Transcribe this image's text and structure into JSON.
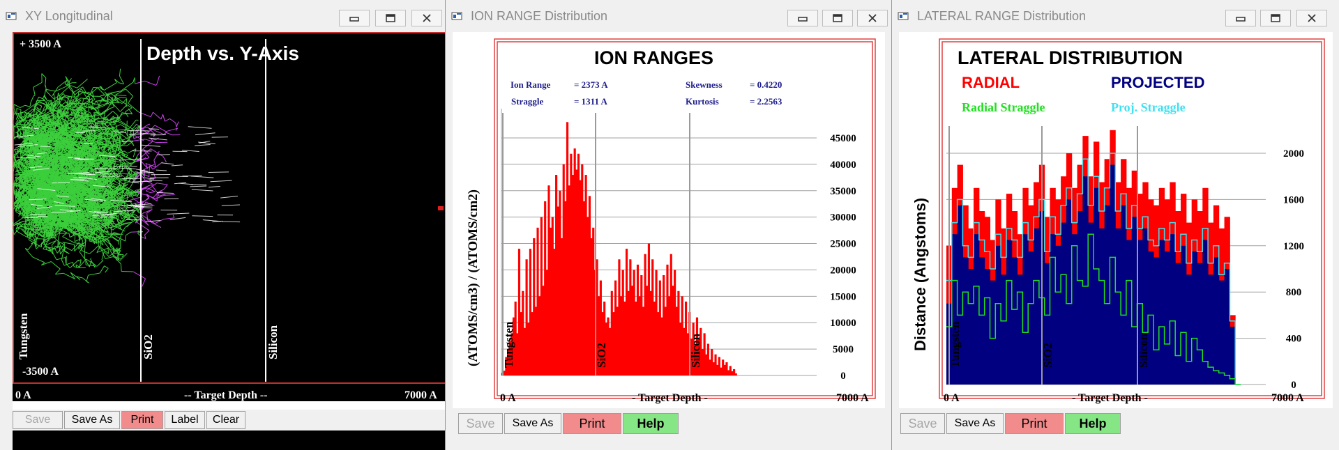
{
  "windows": [
    {
      "title": "XY Longitudinal",
      "plot": {
        "title": "Depth vs. Y-Axis",
        "y_top": "+ 3500 A",
        "y_bottom": "-3500 A",
        "x_left": "0 A",
        "x_mid": "-- Target Depth --",
        "x_right": "7000 A",
        "layers": [
          "Tungsten",
          "SiO2",
          "Silicon"
        ]
      },
      "toolbar": [
        "Save",
        "Save As",
        "Print",
        "Label",
        "Clear"
      ]
    },
    {
      "title": "ION RANGE Distribution",
      "toolbar": [
        "Save",
        "Save As",
        "Print",
        "Help"
      ]
    },
    {
      "title": "LATERAL RANGE Distribution",
      "toolbar": [
        "Save",
        "Save As",
        "Print",
        "Help"
      ]
    }
  ],
  "colors": {
    "red": "#ff0000",
    "navy": "#000080",
    "green": "#20e020",
    "cyan": "#40e0f0",
    "purple": "#cc40ee",
    "label_blue": "#1c1c8c"
  },
  "chart_data": [
    {
      "type": "bar",
      "title": "ION RANGES",
      "stats": {
        "ion_range_label": "Ion Range",
        "ion_range_value": "= 2373 A",
        "straggle_label": "Straggle",
        "straggle_value": "= 1311 A",
        "skewness_label": "Skewness",
        "skewness_value": "= 0.4220",
        "kurtosis_label": "Kurtosis",
        "kurtosis_value": "= 2.2563"
      },
      "ylabel": "(ATOMS/cm3) / (ATOMS/cm2)",
      "xlabel": "- Target Depth -",
      "x_left": "0 A",
      "x_right": "7000 A",
      "ylim": [
        0,
        45000
      ],
      "yticks": [
        "45000",
        "40000",
        "35000",
        "30000",
        "25000",
        "20000",
        "15000",
        "10000",
        "5000",
        "0"
      ],
      "layers": [
        "Tungsten",
        "SiO2",
        "Silicon"
      ],
      "layer_boundaries": [
        0,
        1800,
        3600
      ],
      "values": [
        500,
        900,
        3500,
        5000,
        6500,
        8000,
        11000,
        14000,
        8000,
        24000,
        12000,
        16000,
        9000,
        22000,
        10000,
        24000,
        12000,
        26000,
        13000,
        28000,
        15000,
        30000,
        17000,
        33000,
        20000,
        36000,
        28000,
        30000,
        24000,
        38000,
        32000,
        35000,
        26000,
        40000,
        33000,
        48000,
        36000,
        42000,
        38000,
        43000,
        39000,
        42000,
        37000,
        40000,
        33000,
        38000,
        30000,
        34000,
        26000,
        28000,
        20000,
        22000,
        15000,
        18000,
        12000,
        14000,
        10000,
        11000,
        9000,
        16000,
        12000,
        18000,
        13000,
        22000,
        15000,
        20000,
        14000,
        24000,
        16000,
        22000,
        17000,
        20000,
        14000,
        21000,
        15000,
        19000,
        13000,
        23000,
        17000,
        25000,
        16000,
        22000,
        14000,
        20000,
        12000,
        18000,
        11000,
        19000,
        13000,
        21000,
        15000,
        23000,
        17000,
        20000,
        13000,
        16000,
        10000,
        15000,
        9000,
        14000,
        8000,
        12000,
        7000,
        10000,
        6000,
        11000,
        7000,
        9000,
        5000,
        8000,
        4000,
        6000,
        3000,
        5000,
        2500,
        4000,
        2000,
        3500,
        1500,
        3000,
        2000,
        2500,
        1000,
        1800,
        800,
        1200,
        400,
        0
      ],
      "grid": true
    },
    {
      "type": "area",
      "title": "LATERAL DISTRIBUTION",
      "legend": [
        "RADIAL",
        "PROJECTED",
        "Radial Straggle",
        "Proj. Straggle"
      ],
      "ylabel": "Distance (Angstoms)",
      "xlabel": "- Target Depth -",
      "x_left": "0 A",
      "x_right": "7000 A",
      "ylim": [
        0,
        2200
      ],
      "yticks": [
        "2000",
        "1600",
        "1200",
        "800",
        "400",
        "0"
      ],
      "layers": [
        "Tungsten",
        "SiO2",
        "Silicon"
      ],
      "series": [
        {
          "name": "RADIAL",
          "values": [
            1200,
            1700,
            1900,
            1550,
            1350,
            1700,
            1500,
            1450,
            1250,
            1600,
            1350,
            1650,
            1500,
            1300,
            1700,
            1550,
            1750,
            1900,
            1450,
            1700,
            1600,
            1800,
            2000,
            1700,
            1900,
            2150,
            1800,
            2100,
            1750,
            1950,
            2200,
            1750,
            1950,
            1700,
            1850,
            1650,
            1750,
            1600,
            1550,
            1700,
            1600,
            1750,
            1500,
            1650,
            1400,
            1600,
            1500,
            1700,
            1400,
            1550,
            1350,
            1450,
            600,
            0
          ]
        },
        {
          "name": "PROJECTED",
          "values": [
            700,
            1300,
            1550,
            1100,
            1000,
            1300,
            1100,
            1000,
            900,
            1200,
            950,
            1250,
            1100,
            950,
            1300,
            1150,
            1350,
            1500,
            1050,
            1300,
            1200,
            1400,
            1600,
            1300,
            1500,
            1800,
            1400,
            1700,
            1350,
            1550,
            1900,
            1350,
            1550,
            1250,
            1450,
            1250,
            1350,
            1150,
            1100,
            1250,
            1150,
            1300,
            1050,
            1200,
            950,
            1150,
            1050,
            1250,
            950,
            1100,
            900,
            1000,
            500,
            0
          ]
        },
        {
          "name": "Radial Straggle",
          "values": [
            500,
            900,
            600,
            800,
            700,
            850,
            600,
            750,
            400,
            700,
            550,
            900,
            650,
            800,
            450,
            700,
            900,
            750,
            600,
            1100,
            800,
            950,
            700,
            1200,
            900,
            850,
            1300,
            1000,
            900,
            700,
            1100,
            800,
            600,
            900,
            500,
            700,
            450,
            600,
            300,
            500,
            350,
            550,
            250,
            450,
            200,
            400,
            300,
            200,
            150,
            120,
            100,
            80,
            50,
            0
          ]
        },
        {
          "name": "Proj. Straggle",
          "values": [
            900,
            1400,
            1600,
            1200,
            1100,
            1400,
            1250,
            1150,
            1000,
            1300,
            1100,
            1350,
            1250,
            1100,
            1400,
            1250,
            1450,
            1600,
            1150,
            1450,
            1300,
            1550,
            1700,
            1400,
            1650,
            1950,
            1550,
            1800,
            1500,
            1700,
            2000,
            1500,
            1650,
            1350,
            1550,
            1350,
            1450,
            1250,
            1200,
            1350,
            1250,
            1400,
            1150,
            1300,
            1050,
            1250,
            1150,
            1350,
            1050,
            1200,
            950,
            1050,
            550,
            0
          ]
        }
      ],
      "grid": true
    }
  ]
}
